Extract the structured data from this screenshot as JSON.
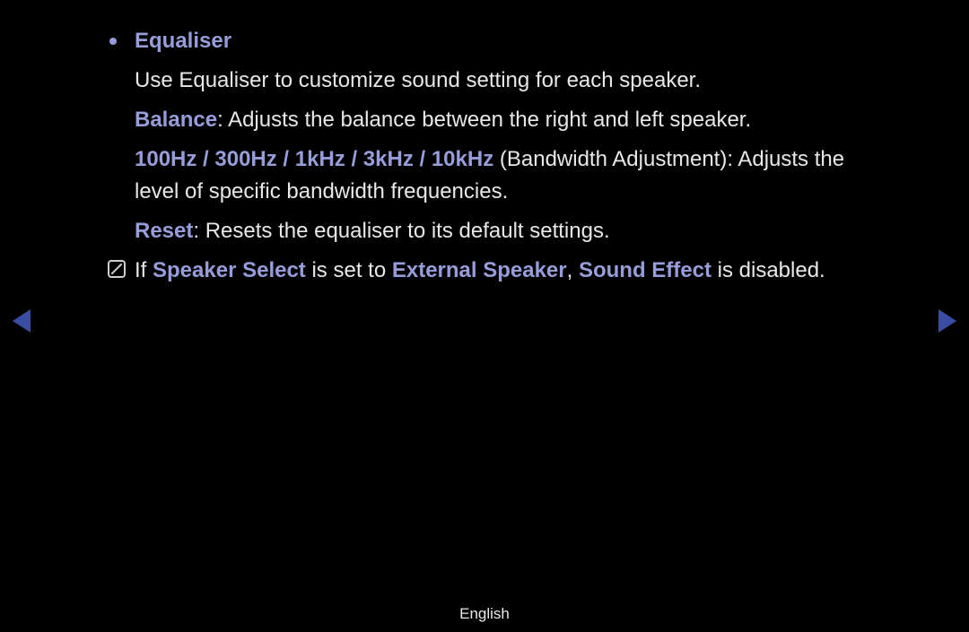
{
  "section": {
    "title": "Equaliser",
    "intro": "Use Equaliser to customize sound setting for each speaker.",
    "items": [
      {
        "key": "Balance",
        "text": ": Adjusts the balance between the right and left speaker."
      },
      {
        "key": "100Hz / 300Hz / 1kHz / 3kHz / 10kHz",
        "paren": " (Bandwidth Adjustment)",
        "text": ": Adjusts the level of specific bandwidth frequencies."
      },
      {
        "key": "Reset",
        "text": ": Resets the equaliser to its default settings."
      }
    ],
    "note": {
      "t1": "If ",
      "k1": "Speaker Select",
      "t2": " is set to ",
      "k2": "External Speaker",
      "t3": ", ",
      "k3": "Sound Effect",
      "t4": " is disabled."
    }
  },
  "footer": "English"
}
